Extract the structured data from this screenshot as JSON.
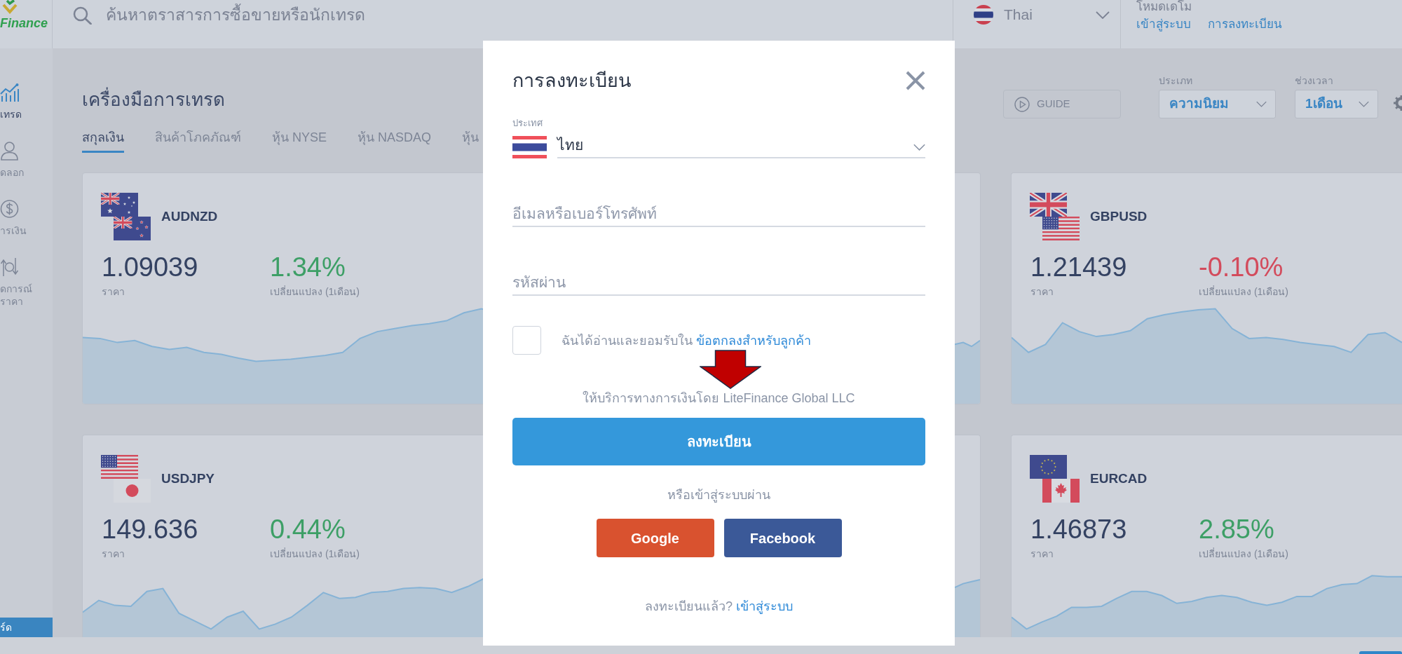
{
  "logo": {
    "text": "Finance"
  },
  "search": {
    "placeholder": "ค้นหาตราสารการซื้อขายหรือนักเทรด"
  },
  "language": {
    "label": "Thai"
  },
  "account": {
    "mode": "โหมดเดโม",
    "login": "เข้าสู่ระบบ",
    "register": "การลงทะเบียน"
  },
  "sidebar": {
    "items": [
      {
        "label": "เทรด",
        "selected": true
      },
      {
        "label": "ดลอก",
        "selected": false
      },
      {
        "label": "ารเงิน",
        "selected": false
      },
      {
        "label": "ดการณ์\nราคา",
        "selected": false
      }
    ],
    "bottom_button": "ร์ด"
  },
  "page": {
    "title": "เครื่องมือการเทรด",
    "tabs": [
      {
        "label": "สกุลเงิน",
        "selected": true
      },
      {
        "label": "สินค้าโภคภัณฑ์",
        "selected": false
      },
      {
        "label": "หุ้น NYSE",
        "selected": false
      },
      {
        "label": "หุ้น NASDAQ",
        "selected": false
      },
      {
        "label": "หุ้น",
        "selected": false
      }
    ],
    "guide_button": "GUIDE",
    "filters": [
      {
        "label": "ประเภท",
        "value": "ความนิยม"
      },
      {
        "label": "ช่วงเวลา",
        "value": "1เดือน"
      }
    ]
  },
  "cards": [
    {
      "pair": "AUDNZD",
      "price": "1.09039",
      "price_label": "ราคา",
      "change": "1.34%",
      "change_label": "เปลี่ยนแปลง (1เดือน)",
      "negative": false
    },
    {
      "pair": "GBPUSD",
      "price": "1.21439",
      "price_label": "ราคา",
      "change": "-0.10%",
      "change_label": "เปลี่ยนแปลง (1เดือน)",
      "negative": true
    },
    {
      "pair": "USDJPY",
      "price": "149.636",
      "price_label": "ราคา",
      "change": "0.44%",
      "change_label": "เปลี่ยนแปลง (1เดือน)",
      "negative": false
    },
    {
      "pair": "EURCAD",
      "price": "1.46873",
      "price_label": "ราคา",
      "change": "2.85%",
      "change_label": "เปลี่ยนแปลง (1เดือน)",
      "negative": false
    }
  ],
  "modal": {
    "title": "การลงทะเบียน",
    "country": {
      "label": "ประเทศ",
      "value": "ไทย"
    },
    "email": {
      "placeholder": "อีเมลหรือเบอร์โทรศัพท์"
    },
    "password": {
      "placeholder": "รหัสผ่าน"
    },
    "agreement": {
      "checked": false,
      "text": "ฉันได้อ่านและยอมรับใน",
      "link": "ข้อตกลงสำหรับลูกค้า"
    },
    "provider_note": "ให้บริการทางการเงินโดย LiteFinance Global LLC",
    "submit": "ลงทะเบียน",
    "social_prompt": "หรือเข้าสู่ระบบผ่าน",
    "social_buttons": [
      {
        "label": "Google",
        "color": "#d9522f"
      },
      {
        "label": "Facebook",
        "color": "#3b5998"
      }
    ],
    "footer": {
      "text": "ลงทะเบียนแล้ว?",
      "link": "เข้าสู่ระบบ"
    }
  }
}
